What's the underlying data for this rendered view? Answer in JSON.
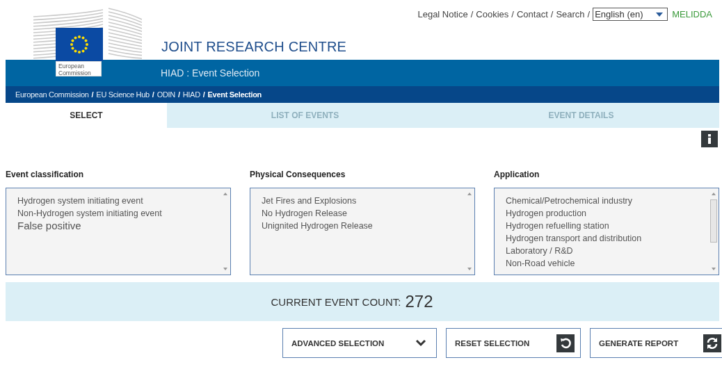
{
  "top_links": [
    "Legal Notice",
    "Cookies",
    "Contact",
    "Search"
  ],
  "link_separator": "/",
  "language": {
    "value": "English (en)"
  },
  "site_link": "MELIDDA",
  "logo": {
    "caption": "European Commission"
  },
  "site_title": "JOINT RESEARCH CENTRE",
  "page_title": "HIAD : Event Selection",
  "breadcrumb": [
    {
      "label": "European Commission",
      "current": false
    },
    {
      "label": "EU Science Hub",
      "current": false
    },
    {
      "label": "ODIN",
      "current": false
    },
    {
      "label": "HIAD",
      "current": false
    },
    {
      "label": "Event Selection",
      "current": true
    }
  ],
  "tabs": [
    {
      "label": "SELECT",
      "selected": true,
      "disabled": false
    },
    {
      "label": "LIST OF EVENTS",
      "selected": false,
      "disabled": true
    },
    {
      "label": "EVENT DETAILS",
      "selected": false,
      "disabled": true
    }
  ],
  "filters": [
    {
      "label": "Event classification",
      "scrollable": false,
      "items": [
        {
          "text": "Hydrogen system initiating event",
          "kind": "normal"
        },
        {
          "text": "Non-Hydrogen system initiating event",
          "kind": "normal"
        },
        {
          "text": "False positive",
          "kind": "large"
        }
      ]
    },
    {
      "label": "Physical Consequences",
      "scrollable": false,
      "items": [
        {
          "text": "Jet Fires and Explosions",
          "kind": "normal"
        },
        {
          "text": "No Hydrogen Release",
          "kind": "normal"
        },
        {
          "text": "Unignited Hydrogen Release",
          "kind": "normal"
        }
      ]
    },
    {
      "label": "Application",
      "scrollable": true,
      "items": [
        {
          "text": "Chemical/Petrochemical industry",
          "kind": "normal"
        },
        {
          "text": "Hydrogen production",
          "kind": "normal"
        },
        {
          "text": "Hydrogen refuelling station",
          "kind": "normal"
        },
        {
          "text": "Hydrogen transport and distribution",
          "kind": "normal"
        },
        {
          "text": "Laboratory / R&D",
          "kind": "normal"
        },
        {
          "text": "Non-Road vehicle",
          "kind": "normal"
        }
      ]
    }
  ],
  "event_count": {
    "label": "CURRENT EVENT COUNT:",
    "value": "272"
  },
  "buttons": [
    {
      "label": "ADVANCED SELECTION",
      "kind": "chevron"
    },
    {
      "label": "RESET SELECTION",
      "kind": "reset"
    },
    {
      "label": "GENERATE REPORT",
      "kind": "refresh"
    }
  ]
}
